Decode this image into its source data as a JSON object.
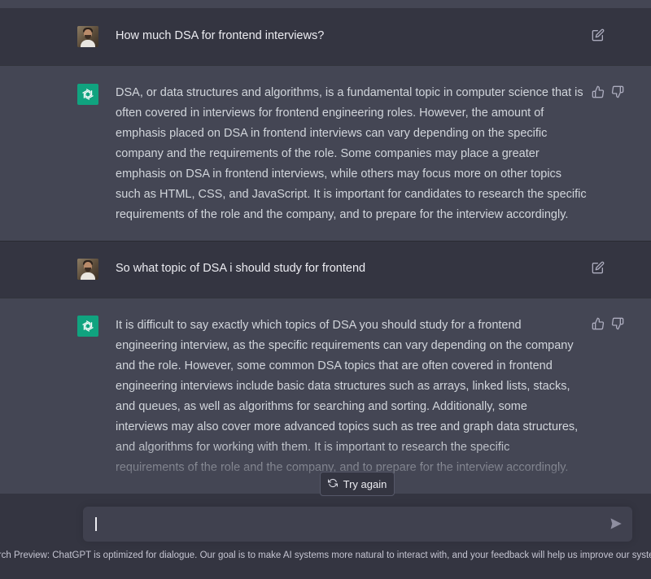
{
  "conversation": [
    {
      "role": "user",
      "text": "How much DSA for frontend interviews?"
    },
    {
      "role": "assistant",
      "text": "DSA, or data structures and algorithms, is a fundamental topic in computer science that is often covered in interviews for frontend engineering roles. However, the amount of emphasis placed on DSA in frontend interviews can vary depending on the specific company and the requirements of the role. Some companies may place a greater emphasis on DSA in frontend interviews, while others may focus more on other topics such as HTML, CSS, and JavaScript. It is important for candidates to research the specific requirements of the role and the company, and to prepare for the interview accordingly."
    },
    {
      "role": "user",
      "text": "So what topic of DSA i should study for frontend"
    },
    {
      "role": "assistant",
      "text": "It is difficult to say exactly which topics of DSA you should study for a frontend engineering interview, as the specific requirements can vary depending on the company and the role. However, some common DSA topics that are often covered in frontend engineering interviews include basic data structures such as arrays, linked lists, stacks, and queues, as well as algorithms for searching and sorting. Additionally, some interviews may also cover more advanced topics such as tree and graph data structures, and algorithms for working with them. It is important to research the specific requirements of the role and the company, and to prepare for the interview accordingly."
    }
  ],
  "icons": {
    "edit": "edit-icon",
    "thumbs_up": "thumbs-up-icon",
    "thumbs_down": "thumbs-down-icon",
    "regenerate": "refresh-icon",
    "send": "send-icon",
    "bot_logo": "openai-logo-icon"
  },
  "try_again_label": "Try again",
  "composer": {
    "value": ""
  },
  "footer": "earch Preview: ChatGPT is optimized for dialogue. Our goal is to make AI systems more natural to interact with, and your feedback will help us improve our syster",
  "colors": {
    "user_bg": "#343541",
    "assistant_bg": "#444654",
    "bot_avatar": "#10a37f",
    "input_bg": "#40414f"
  }
}
